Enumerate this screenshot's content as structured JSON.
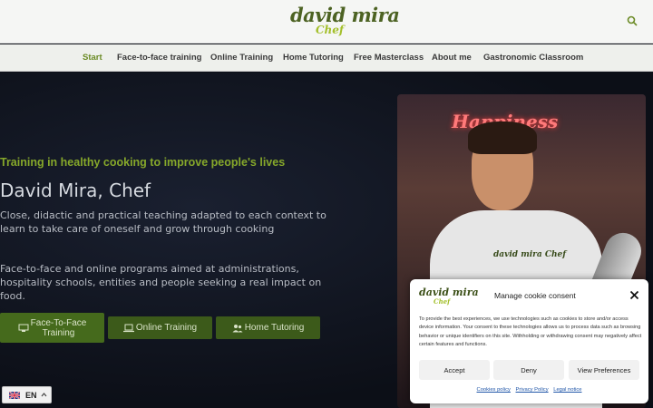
{
  "header": {
    "logo_main": "david mira",
    "logo_sub": "Chef",
    "search_icon": "search-icon"
  },
  "nav": {
    "items": [
      {
        "label": "Start",
        "active": true
      },
      {
        "label": "Face-to-face training"
      },
      {
        "label": "Online Training"
      },
      {
        "label": "Home Tutoring"
      },
      {
        "label": "Free Masterclass"
      },
      {
        "label": "About me"
      },
      {
        "label": "Gastronomic Classroom"
      }
    ]
  },
  "hero": {
    "tagline": "Training in healthy cooking to improve people's lives",
    "title": "David Mira, Chef",
    "description": "Close, didactic and practical teaching adapted to each context to learn to take care of oneself and grow through cooking",
    "description2": "Face-to-face and online programs aimed at administrations, hospitality schools, entities and people seeking a real impact on food.",
    "buttons": [
      {
        "label": "Face-To-Face Training",
        "icon": "classroom-icon"
      },
      {
        "label": "Online Training",
        "icon": "laptop-icon"
      },
      {
        "label": "Home Tutoring",
        "icon": "users-icon"
      }
    ],
    "photo": {
      "neon_text": "Happiness",
      "shirt_logo": "david mira Chef"
    }
  },
  "cookie": {
    "logo_main": "david mira",
    "logo_sub": "Chef",
    "title": "Manage cookie consent",
    "text": "To provide the best experiences, we use technologies such as cookies to store and/or access device information. Your consent to these technologies allows us to process data such as browsing behavior or unique identifiers on this site. Withholding or withdrawing consent may negatively affect certain features and functions.",
    "accept": "Accept",
    "deny": "Deny",
    "preferences": "View Preferences",
    "links": [
      "Cookies policy",
      "Privacy Policy",
      "Legal notice"
    ]
  },
  "language": {
    "code": "EN",
    "flag": "uk-flag-icon"
  },
  "colors": {
    "accent": "#86a82a",
    "button": "#3c5a1a",
    "dark_bg": "#0d1018"
  }
}
